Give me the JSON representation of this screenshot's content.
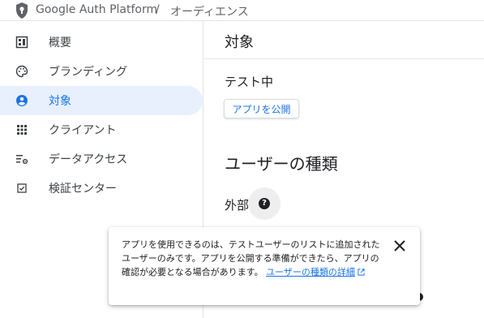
{
  "header": {
    "brand": "Google Auth Platform",
    "separator": "/",
    "current": "オーディエンス"
  },
  "sidebar": {
    "items": [
      {
        "label": "概要",
        "icon": "dashboard-icon"
      },
      {
        "label": "ブランディング",
        "icon": "palette-icon"
      },
      {
        "label": "対象",
        "icon": "account-circle-icon",
        "active": true
      },
      {
        "label": "クライアント",
        "icon": "apps-grid-icon"
      },
      {
        "label": "データアクセス",
        "icon": "data-settings-icon"
      },
      {
        "label": "検証センター",
        "icon": "verified-check-icon"
      }
    ]
  },
  "main": {
    "title": "対象",
    "status": "テスト中",
    "publish_button": "アプリを公開",
    "user_type_heading": "ユーザーの種類",
    "user_type_value": "外部"
  },
  "popover": {
    "message": "アプリを使用できるのは、テストユーザーのリストに追加されたユーザーのみです。アプリを公開する準備ができたら、アプリの確認が必要となる場合があります。",
    "link_text": "ユーザーの種類の詳細"
  },
  "colors": {
    "accent": "#1a73e8",
    "active_bg": "#e8f0fe",
    "text": "#202124"
  }
}
